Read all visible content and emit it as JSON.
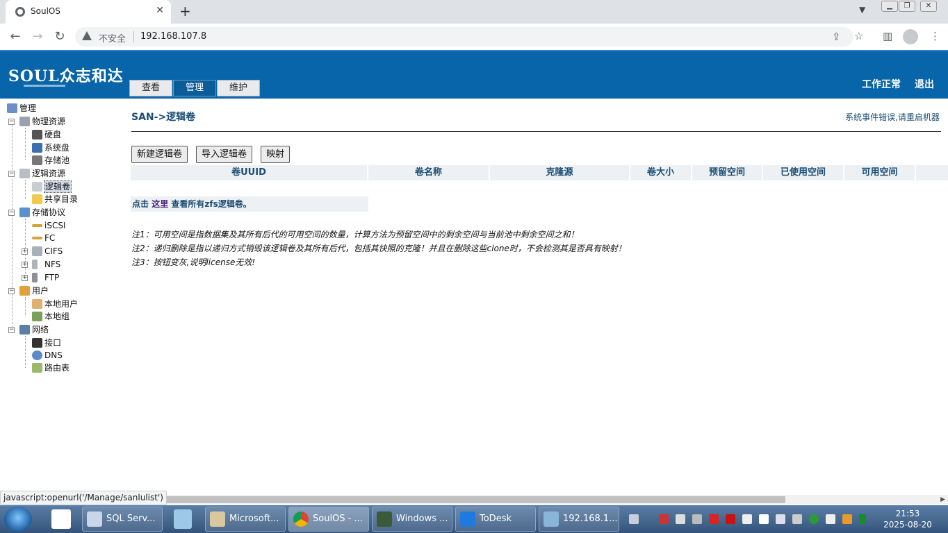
{
  "browser": {
    "tab_title": "SoulOS",
    "tab_close": "✕",
    "new_tab": "+",
    "insecure_label": "不安全",
    "url": "192.168.107.8"
  },
  "header": {
    "logo_text": "SOUL众志和达",
    "nav_tabs": [
      "查看",
      "管理",
      "维护"
    ],
    "active_tab": "管理",
    "status_link": "工作正常",
    "logout_link": "退出"
  },
  "tree": {
    "root": "管理",
    "physical": "物理资源",
    "disk": "硬盘",
    "system_disk": "系统盘",
    "storage_pool": "存储池",
    "logical": "逻辑资源",
    "logical_volume": "逻辑卷",
    "shared_dir": "共享目录",
    "protocols": "存储协议",
    "iscsi": "iSCSI",
    "fc": "FC",
    "cifs": "CIFS",
    "nfs": "NFS",
    "ftp": "FTP",
    "users": "用户",
    "local_users": "本地用户",
    "local_groups": "本地组",
    "network": "网络",
    "interface": "接口",
    "dns": "DNS",
    "routes": "路由表"
  },
  "main": {
    "breadcrumb": "SAN->逻辑卷",
    "system_error": "系统事件错误,请重启机器",
    "buttons": {
      "new_volume": "新建逻辑卷",
      "import_volume": "导入逻辑卷",
      "map": "映射"
    },
    "columns": [
      "卷UUID",
      "卷名称",
      "克隆源",
      "卷大小",
      "预留空间",
      "已使用空间",
      "可用空间"
    ],
    "hint_prefix": "点击",
    "hint_link": "这里",
    "hint_suffix": "查看所有zfs逻辑卷。",
    "notes": [
      "注1：可用空间是指数据集及其所有后代的可用空间的数量，计算方法为预留空间中的剩余空间与当前池中剩余空间之和！",
      "注2：递归删除是指以递归方式销毁该逻辑卷及其所有后代，包括其快照的克隆！并且在删除这些clone时，不会检测其是否具有映射！",
      "注3：按钮变灰,说明license无效!"
    ]
  },
  "status_bar": "javascript:openurl('/Manage/sanlulist')",
  "taskbar": {
    "items": [
      "SQL Serv...",
      "Microsoft...",
      "SoulOS - ...",
      "Windows ...",
      "ToDesk",
      "192.168.1..."
    ],
    "active_item": "SoulOS - ...",
    "time": "21:53",
    "date": "2025-08-20"
  }
}
